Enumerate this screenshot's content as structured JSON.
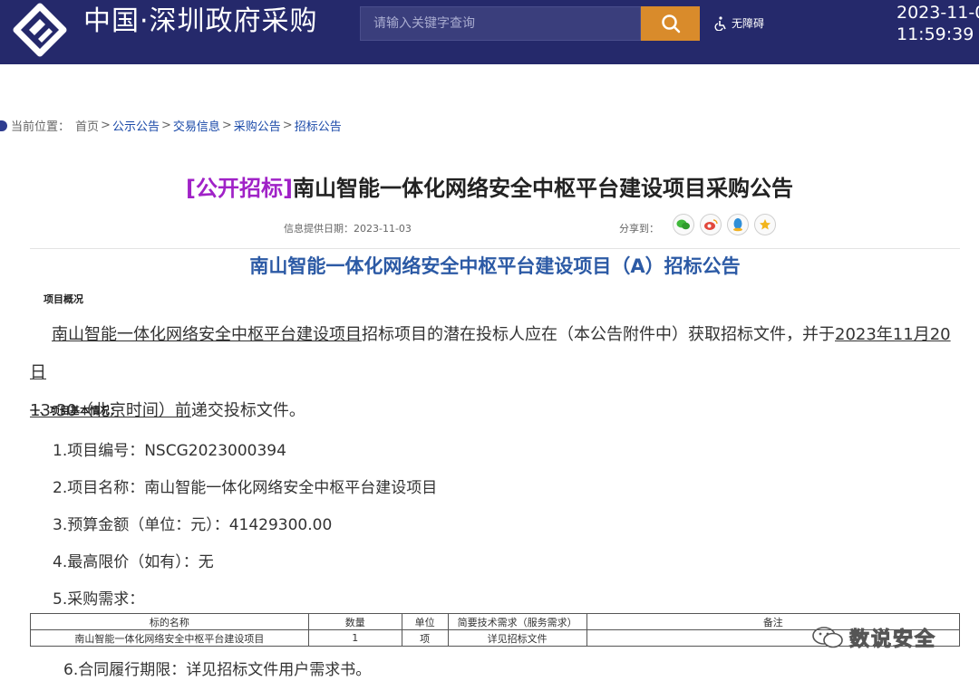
{
  "header": {
    "site_title": "中国·深圳政府采购",
    "search_placeholder": "请输入关键字查询",
    "accessibility_label": "无障碍",
    "date": "2023-11-0",
    "time": "11:59:39"
  },
  "breadcrumb": {
    "label": "当前位置：",
    "items": [
      "首页",
      "公示公告",
      "交易信息",
      "采购公告",
      "招标公告"
    ]
  },
  "article": {
    "title_tag": "[公开招标]",
    "title": "南山智能一体化网络安全中枢平台建设项目采购公告",
    "date_label": "信息提供日期：",
    "date": "2023-11-03",
    "share_label": "分享到：",
    "share_icons": [
      "wechat-icon",
      "weibo-icon",
      "qq-icon",
      "favorite-icon"
    ],
    "subtitle": "南山智能一体化网络安全中枢平台建设项目（A）招标公告",
    "overview_heading": "项目概况",
    "overview_p1_project": "南山智能一体化网络安全中枢平台建设项目",
    "overview_p1_mid": "招标项目的潜在投标人应在（本公告附件中）获取招标文件，并于",
    "overview_p1_deadline_a": "2023年11月20日",
    "overview_p1_deadline_b": "13:30（北京时间）前",
    "overview_p1_end": "递交投标文件。",
    "section1_heading": "一、项目基本情况：",
    "items": [
      "1.项目编号：NSCG2023000394",
      "2.项目名称：南山智能一体化网络安全中枢平台建设项目",
      "3.预算金额（单位：元）：41429300.00",
      "4.最高限价（如有）：无",
      "5.采购需求："
    ],
    "item6": "6.合同履行期限：详见招标文件用户需求书。"
  },
  "requirements_table": {
    "headers": [
      "标的名称",
      "数量",
      "单位",
      "简要技术需求（服务需求）",
      "备注"
    ],
    "rows": [
      [
        "南山智能一体化网络安全中枢平台建设项目",
        "1",
        "项",
        "详见招标文件",
        ""
      ]
    ]
  },
  "watermark": {
    "text": "数说安全"
  },
  "colors": {
    "header_bg": "#25296b",
    "search_button": "#d98b2b",
    "title_tag": "#a022c7",
    "subtitle": "#2c5aa5",
    "link": "#1a49a8"
  }
}
